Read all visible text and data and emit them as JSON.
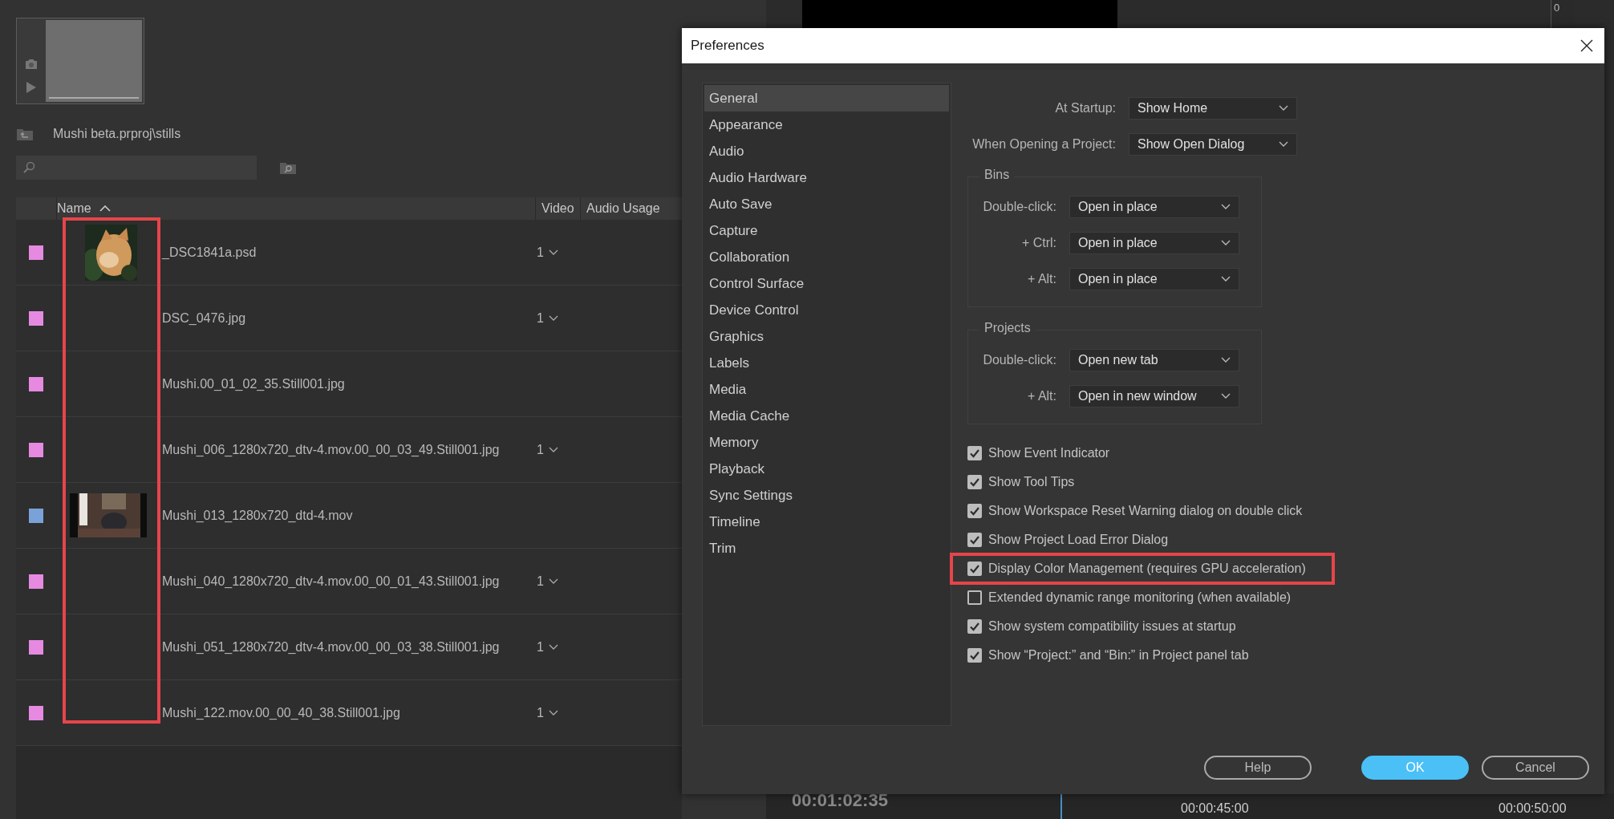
{
  "project_panel": {
    "path": "Mushi beta.prproj\\stills",
    "columns": [
      {
        "label": "Name",
        "sorted": true
      },
      {
        "label": "Video"
      },
      {
        "label": "Audio Usage"
      }
    ],
    "thumbnail_column_highlighted": true,
    "rows": [
      {
        "color": "#e58ae0",
        "name": "_DSC1841a.psd",
        "video": "1"
      },
      {
        "color": "#e58ae0",
        "name": "DSC_0476.jpg",
        "video": "1"
      },
      {
        "color": "#e58ae0",
        "name": "Mushi.00_01_02_35.Still001.jpg"
      },
      {
        "color": "#e58ae0",
        "name": "Mushi_006_1280x720_dtv-4.mov.00_00_03_49.Still001.jpg",
        "video": "1"
      },
      {
        "color": "#7aa2d8",
        "name": "Mushi_013_1280x720_dtd-4.mov"
      },
      {
        "color": "#e58ae0",
        "name": "Mushi_040_1280x720_dtv-4.mov.00_00_01_43.Still001.jpg",
        "video": "1"
      },
      {
        "color": "#e58ae0",
        "name": "Mushi_051_1280x720_dtv-4.mov.00_00_03_38.Still001.jpg",
        "video": "1"
      },
      {
        "color": "#e58ae0",
        "name": "Mushi_122.mov.00_00_40_38.Still001.jpg",
        "video": "1"
      }
    ]
  },
  "monitor": {
    "ruler_label": "0"
  },
  "timeline": {
    "timecode": "00:01:02:35",
    "ticks": [
      "00:00:45:00",
      "00:00:50:00"
    ]
  },
  "dialog": {
    "title": "Preferences",
    "categories": [
      {
        "label": "General",
        "selected": true
      },
      {
        "label": "Appearance",
        "selected": false
      },
      {
        "label": "Audio",
        "selected": false
      },
      {
        "label": "Audio Hardware",
        "selected": false
      },
      {
        "label": "Auto Save",
        "selected": false
      },
      {
        "label": "Capture",
        "selected": false
      },
      {
        "label": "Collaboration",
        "selected": false
      },
      {
        "label": "Control Surface",
        "selected": false
      },
      {
        "label": "Device Control",
        "selected": false
      },
      {
        "label": "Graphics",
        "selected": false
      },
      {
        "label": "Labels",
        "selected": false
      },
      {
        "label": "Media",
        "selected": false
      },
      {
        "label": "Media Cache",
        "selected": false
      },
      {
        "label": "Memory",
        "selected": false
      },
      {
        "label": "Playback",
        "selected": false
      },
      {
        "label": "Sync Settings",
        "selected": false
      },
      {
        "label": "Timeline",
        "selected": false
      },
      {
        "label": "Trim",
        "selected": false
      }
    ],
    "settings": [
      {
        "label": "At Startup:",
        "value": "Show Home"
      },
      {
        "label": "When Opening a Project:",
        "value": "Show Open Dialog"
      }
    ],
    "groups": [
      {
        "title": "Bins",
        "rows": [
          {
            "label": "Double-click:",
            "value": "Open in place"
          },
          {
            "label": "+ Ctrl:",
            "value": "Open in place"
          },
          {
            "label": "+ Alt:",
            "value": "Open in place"
          }
        ]
      },
      {
        "title": "Projects",
        "rows": [
          {
            "label": "Double-click:",
            "value": "Open new tab"
          },
          {
            "label": "+ Alt:",
            "value": "Open in new window"
          }
        ]
      }
    ],
    "options": [
      {
        "label": "Show Event Indicator",
        "checked": true
      },
      {
        "label": "Show Tool Tips",
        "checked": true
      },
      {
        "label": "Show Workspace Reset Warning dialog on double click",
        "checked": true
      },
      {
        "label": "Show Project Load Error Dialog",
        "checked": true
      },
      {
        "label": "Display Color Management (requires GPU acceleration)",
        "checked": true,
        "highlighted": true
      },
      {
        "label": "Extended dynamic range monitoring (when available)",
        "checked": false
      },
      {
        "label": "Show system compatibility issues at startup",
        "checked": true
      },
      {
        "label": "Show “Project:” and “Bin:” in Project panel tab",
        "checked": true
      }
    ],
    "buttons": [
      {
        "label": "Help",
        "kind": "secondary"
      },
      {
        "label": "OK",
        "kind": "primary"
      },
      {
        "label": "Cancel",
        "kind": "secondary"
      }
    ]
  }
}
